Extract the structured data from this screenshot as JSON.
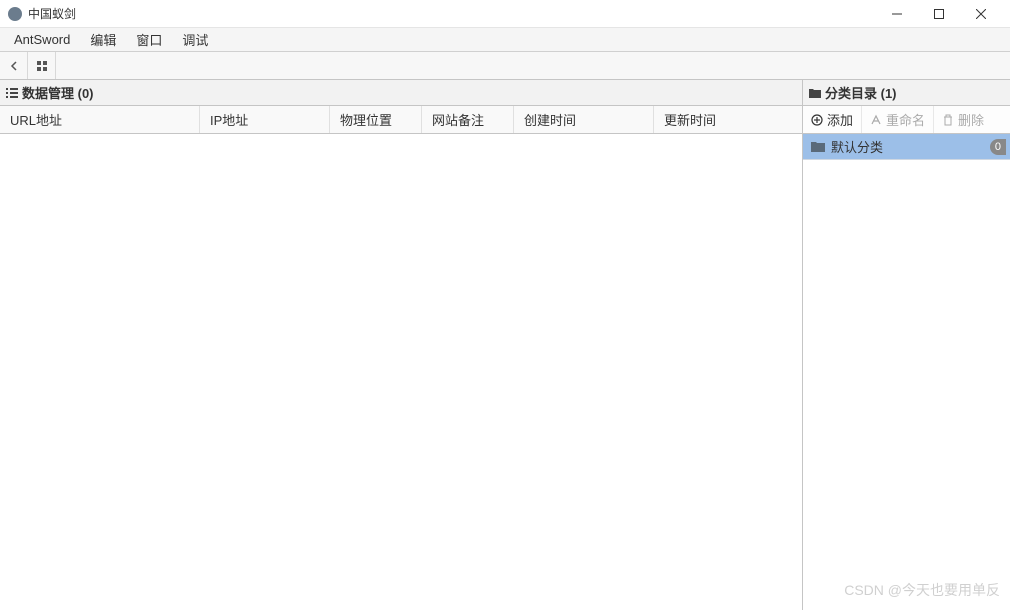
{
  "window": {
    "title": "中国蚁剑"
  },
  "menubar": {
    "items": [
      "AntSword",
      "编辑",
      "窗口",
      "调试"
    ]
  },
  "leftPanel": {
    "title": "数据管理 (0)",
    "columns": [
      "URL地址",
      "IP地址",
      "物理位置",
      "网站备注",
      "创建时间",
      "更新时间"
    ]
  },
  "rightPanel": {
    "title": "分类目录 (1)",
    "toolbar": {
      "add": "添加",
      "rename": "重命名",
      "delete": "删除"
    },
    "categories": [
      {
        "name": "默认分类",
        "count": "0"
      }
    ]
  },
  "watermark": "CSDN @今天也要用单反"
}
